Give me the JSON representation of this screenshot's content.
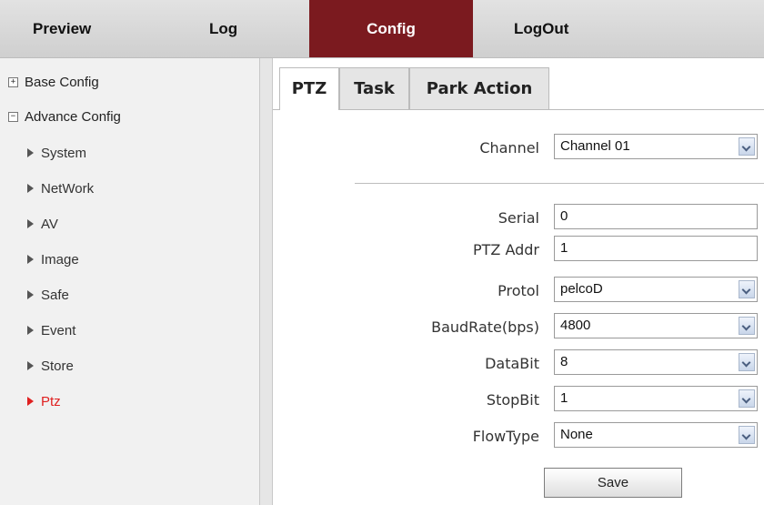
{
  "topnav": {
    "items": [
      {
        "label": "Preview"
      },
      {
        "label": "Log"
      },
      {
        "label": "Config"
      },
      {
        "label": "LogOut"
      }
    ]
  },
  "sidebar": {
    "base_config": {
      "label": "Base Config",
      "expander": "+"
    },
    "advance_config": {
      "label": "Advance Config",
      "expander": "−"
    },
    "items": [
      {
        "label": "System"
      },
      {
        "label": "NetWork"
      },
      {
        "label": "AV"
      },
      {
        "label": "Image"
      },
      {
        "label": "Safe"
      },
      {
        "label": "Event"
      },
      {
        "label": "Store"
      },
      {
        "label": "Ptz"
      }
    ]
  },
  "tabs": [
    {
      "label": "PTZ"
    },
    {
      "label": "Task"
    },
    {
      "label": "Park Action"
    }
  ],
  "form": {
    "channel": {
      "label": "Channel",
      "value": "Channel 01"
    },
    "serial": {
      "label": "Serial",
      "value": "0"
    },
    "ptz_addr": {
      "label": "PTZ Addr",
      "value": "1"
    },
    "protol": {
      "label": "Protol",
      "value": "pelcoD"
    },
    "baudrate": {
      "label": "BaudRate(bps)",
      "value": "4800"
    },
    "databit": {
      "label": "DataBit",
      "value": "8"
    },
    "stopbit": {
      "label": "StopBit",
      "value": "1"
    },
    "flowtype": {
      "label": "FlowType",
      "value": "None"
    },
    "save_label": "Save"
  },
  "colors": {
    "active_nav": "#7b1a1f",
    "active_tree_item": "#e02020"
  }
}
